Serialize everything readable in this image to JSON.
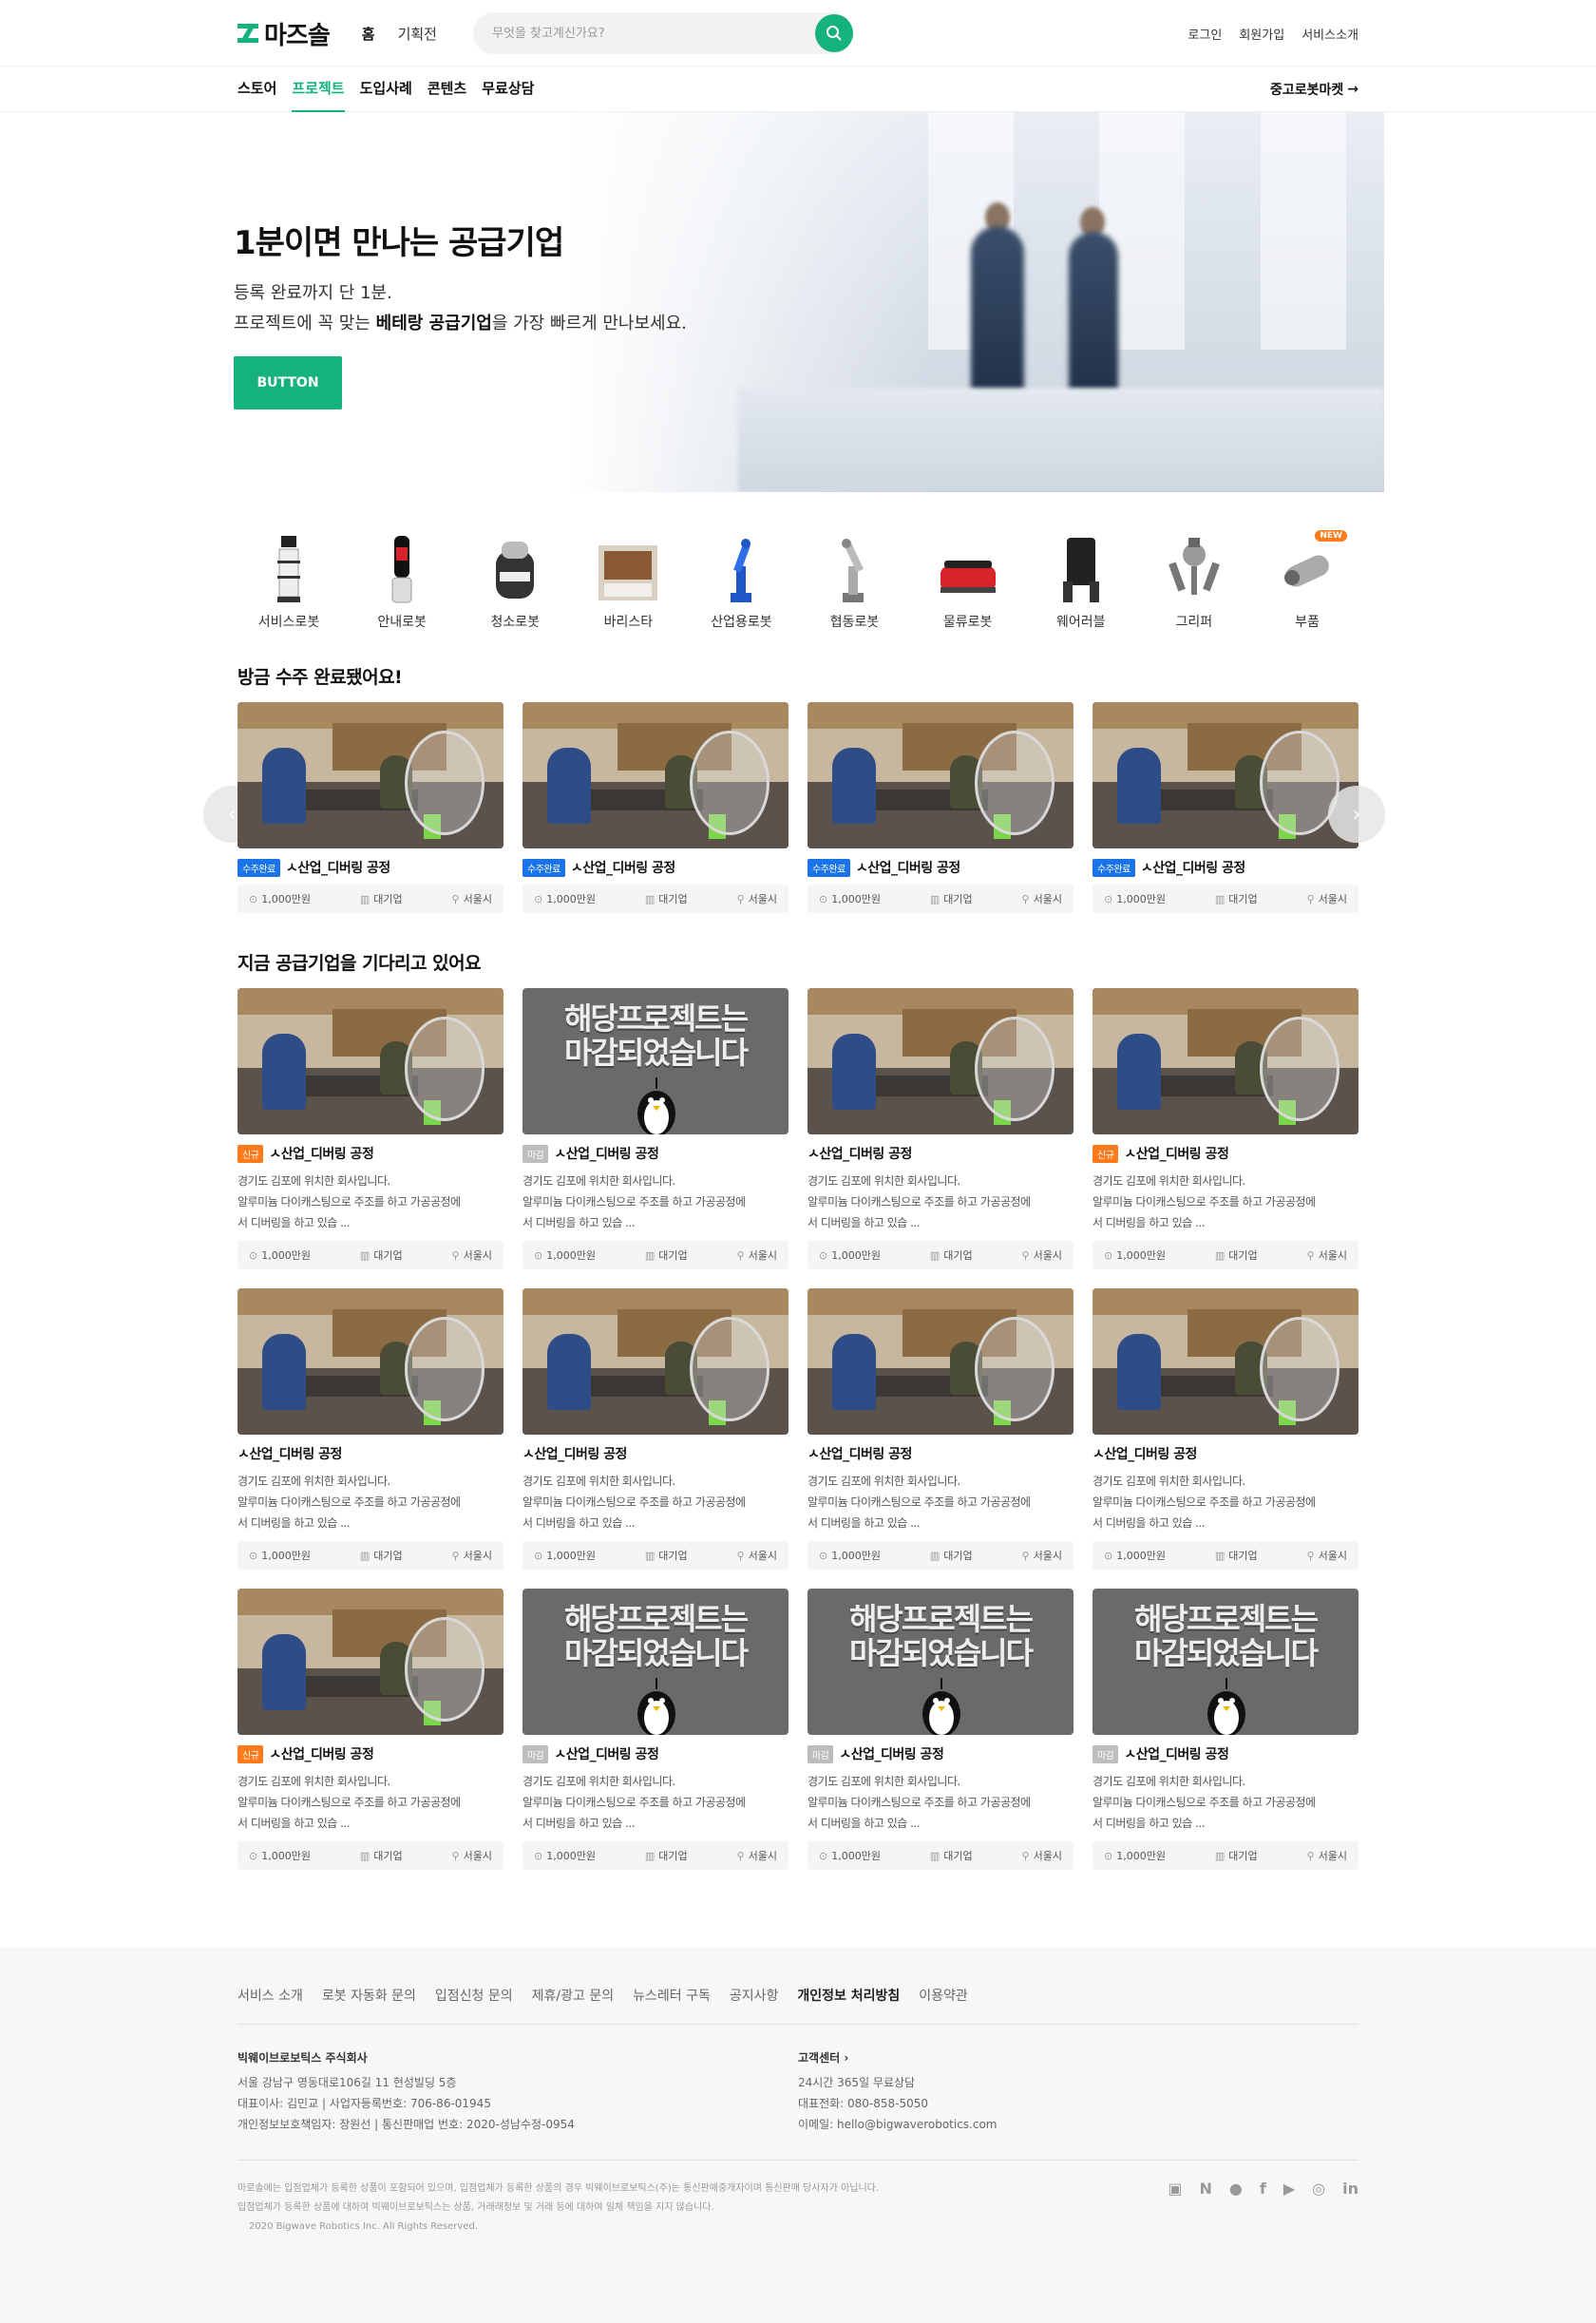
{
  "brand": {
    "logo_text": "마즈솔",
    "accent": "#15b27d"
  },
  "topnav": {
    "home": "홈",
    "special": "기획전"
  },
  "search": {
    "placeholder": "무엇을 찾고계신가요?"
  },
  "toplinks": {
    "login": "로그인",
    "signup": "회원가입",
    "about": "서비스소개"
  },
  "subnav": {
    "tabs": [
      "스토어",
      "프로젝트",
      "도입사례",
      "콘텐츠",
      "무료상담"
    ],
    "active_tab": "프로젝트",
    "market": "중고로봇마켓"
  },
  "hero": {
    "title": "1분이면 만나는 공급기업",
    "line1": "등록 완료까지 단 1분.",
    "line2_pre": "프로젝트에 꼭 맞는 ",
    "line2_bold": "베테랑 공급기업",
    "line2_post": "을 가장 빠르게 만나보세요.",
    "button": "BUTTON"
  },
  "categories": [
    {
      "label": "서비스로봇",
      "icon": "service-robot-icon"
    },
    {
      "label": "안내로봇",
      "icon": "guide-robot-icon"
    },
    {
      "label": "청소로봇",
      "icon": "cleaning-robot-icon"
    },
    {
      "label": "바리스타",
      "icon": "barista-robot-icon"
    },
    {
      "label": "산업용로봇",
      "icon": "industrial-robot-icon"
    },
    {
      "label": "협동로봇",
      "icon": "cobot-icon"
    },
    {
      "label": "물류로봇",
      "icon": "logistics-robot-icon"
    },
    {
      "label": "웨어러블",
      "icon": "wearable-robot-icon"
    },
    {
      "label": "그리퍼",
      "icon": "gripper-icon"
    },
    {
      "label": "부품",
      "icon": "parts-icon",
      "badge": "NEW"
    }
  ],
  "completed": {
    "title": "방금 수주 완료됐어요!",
    "cards": [
      {
        "badge": "수주완료",
        "name": "ㅅ산업_디버링 공정",
        "price": "1,000만원",
        "company": "대기업",
        "region": "서울시"
      },
      {
        "badge": "수주완료",
        "name": "ㅅ산업_디버링 공정",
        "price": "1,000만원",
        "company": "대기업",
        "region": "서울시"
      },
      {
        "badge": "수주완료",
        "name": "ㅅ산업_디버링 공정",
        "price": "1,000만원",
        "company": "대기업",
        "region": "서울시"
      },
      {
        "badge": "수주완료",
        "name": "ㅅ산업_디버링 공정",
        "price": "1,000만원",
        "company": "대기업",
        "region": "서울시"
      }
    ]
  },
  "waiting": {
    "title": "지금 공급기업을 기다리고 있어요",
    "closed_text_line1": "해당프로젝트는",
    "closed_text_line2": "마감되었습니다",
    "desc1": "경기도 김포에 위치한 회사입니다.",
    "desc2": "알루미늄 다이캐스팅으로 주조를 하고 가공공정에",
    "desc3": "서 디버링을 하고 있습 ...",
    "rows": [
      [
        {
          "badge": "신규",
          "badge_type": "new",
          "closed": false,
          "name": "ㅅ산업_디버링 공정"
        },
        {
          "badge": "마감",
          "badge_type": "closed",
          "closed": true,
          "name": "ㅅ산업_디버링 공정"
        },
        {
          "badge": "",
          "badge_type": "",
          "closed": false,
          "name": "ㅅ산업_디버링 공정"
        },
        {
          "badge": "신규",
          "badge_type": "new",
          "closed": false,
          "name": "ㅅ산업_디버링 공정"
        }
      ],
      [
        {
          "badge": "",
          "badge_type": "",
          "closed": false,
          "name": "ㅅ산업_디버링 공정"
        },
        {
          "badge": "",
          "badge_type": "",
          "closed": false,
          "name": "ㅅ산업_디버링 공정"
        },
        {
          "badge": "",
          "badge_type": "",
          "closed": false,
          "name": "ㅅ산업_디버링 공정"
        },
        {
          "badge": "",
          "badge_type": "",
          "closed": false,
          "name": "ㅅ산업_디버링 공정"
        }
      ],
      [
        {
          "badge": "신규",
          "badge_type": "new",
          "closed": false,
          "name": "ㅅ산업_디버링 공정"
        },
        {
          "badge": "마감",
          "badge_type": "closed",
          "closed": true,
          "name": "ㅅ산업_디버링 공정"
        },
        {
          "badge": "마감",
          "badge_type": "closed",
          "closed": true,
          "name": "ㅅ산업_디버링 공정"
        },
        {
          "badge": "마감",
          "badge_type": "closed",
          "closed": true,
          "name": "ㅅ산업_디버링 공정"
        }
      ]
    ],
    "price": "1,000만원",
    "company": "대기업",
    "region": "서울시"
  },
  "footer": {
    "links": [
      "서비스 소개",
      "로봇 자동화 문의",
      "입점신청 문의",
      "제휴/광고 문의",
      "뉴스레터 구독",
      "공지사항",
      "개인정보 처리방침",
      "이용약관"
    ],
    "bold_link": "개인정보 처리방침",
    "company": "빅웨이브로보틱스 주식회사",
    "address": "서울 강남구 영동대로106길 11 현성빌딩 5층",
    "ceo": "대표이사: 김민교 | 사업자등록번호: 706-86-01945",
    "privacy": "개인정보보호책임자: 장원선 | 통신판매업 번호: 2020-성남수정-0954",
    "cs_title": "고객센터",
    "cs_hours": "24시간 365일 무료상담",
    "cs_phone": "대표전화: 080-858-5050",
    "cs_email": "이메일: hello@bigwaverobotics.com",
    "note1": "마로솔에는 입점업체가 등록한 상품이 포함되어 있으며, 입점업체가 등록한 상품의 경우 빅웨이브로보틱스(주)는 통신판매중개자이며 통신판매 당사자가 아닙니다.",
    "note2": "입점업체가 등록한 상품에 대하여 빅웨이브로보틱스는 상품, 거래래정보 및 거래 등에 대하여 일체 책임을 지지 않습니다.",
    "copyright": "2020 Bigwave Robotics Inc. All Rights Reserved.",
    "social": [
      "blog-icon",
      "naver-icon",
      "kakao-icon",
      "facebook-icon",
      "youtube-icon",
      "instagram-icon",
      "linkedin-icon"
    ]
  }
}
